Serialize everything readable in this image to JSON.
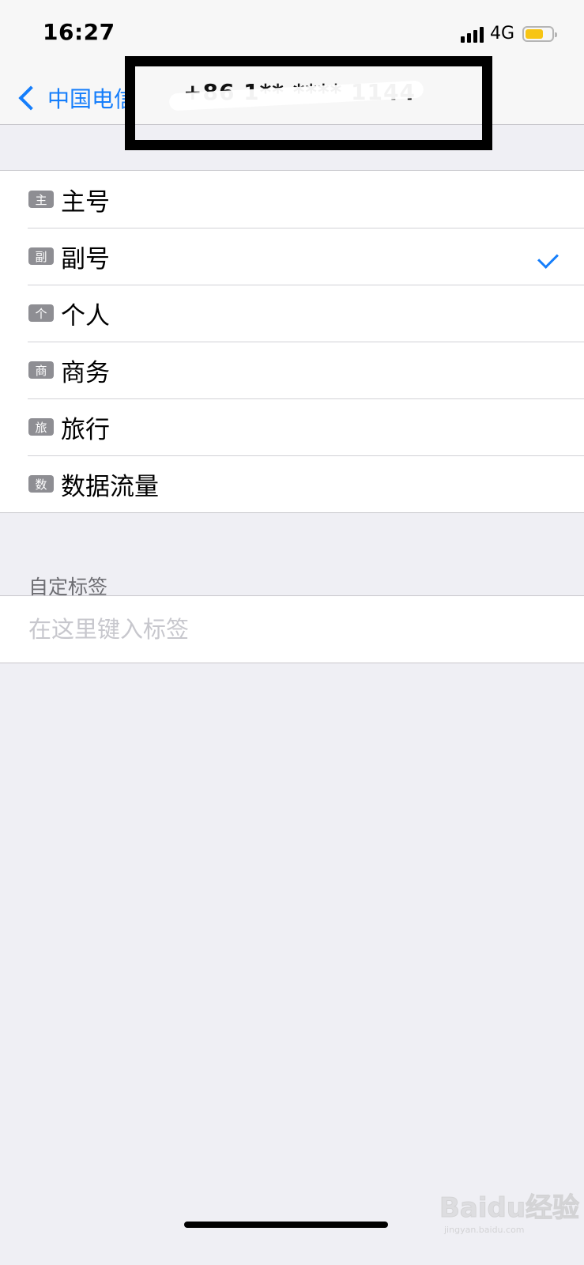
{
  "status_bar": {
    "time": "16:27",
    "network": "4G"
  },
  "nav": {
    "back_label": "中国电信",
    "title": "+86 1** **** 1144"
  },
  "labels": [
    {
      "badge": "主",
      "label": "主号",
      "selected": false
    },
    {
      "badge": "副",
      "label": "副号",
      "selected": true
    },
    {
      "badge": "个",
      "label": "个人",
      "selected": false
    },
    {
      "badge": "商",
      "label": "商务",
      "selected": false
    },
    {
      "badge": "旅",
      "label": "旅行",
      "selected": false
    },
    {
      "badge": "数",
      "label": "数据流量",
      "selected": false
    }
  ],
  "custom_label": {
    "header": "自定标签",
    "placeholder": "在这里键入标签"
  },
  "watermark": {
    "logo": "Baidu经验",
    "url": "jingyan.baidu.com"
  },
  "colors": {
    "accent": "#157efb",
    "battery": "#f7c514",
    "background": "#efeff4"
  }
}
